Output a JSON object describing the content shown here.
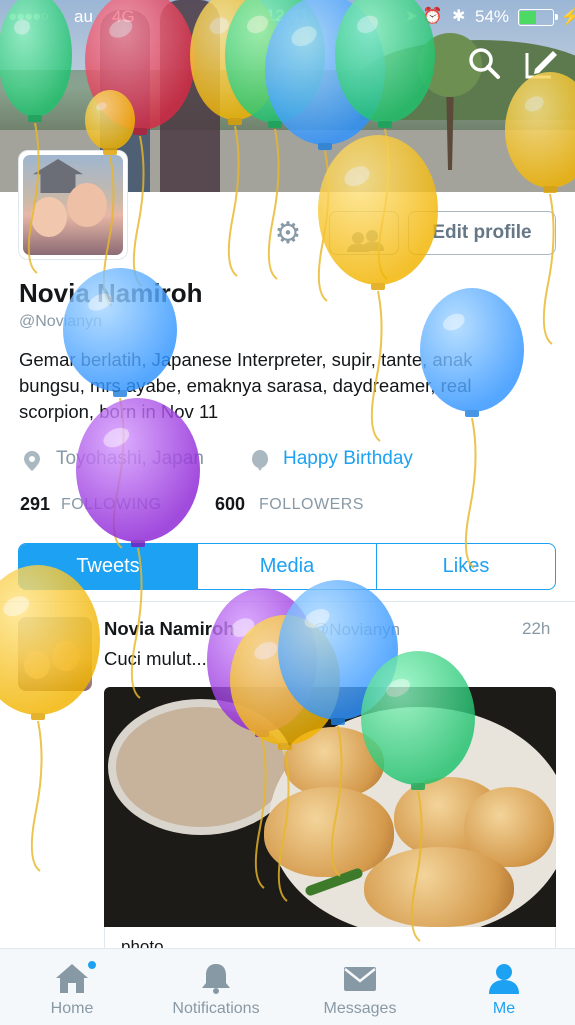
{
  "status_bar": {
    "signal": "●●●●○",
    "carrier": "au",
    "network": "4G",
    "time": "12:41",
    "battery_percent": "54%",
    "battery_level": 0.54
  },
  "profile": {
    "name": "Novia Namiroh",
    "handle": "@Novianyn",
    "bio": "Gemar berlatih, Japanese Interpreter, supir, tante, anak bungsu, mrs ayabe, emaknya sarasa, daydreamer, real scorpion, born in Nov 11",
    "location": "Toyohashi, Japan",
    "birthday": "Happy Birthday",
    "edit_profile_label": "Edit profile",
    "following_count": "291",
    "following_label": "FOLLOWING",
    "followers_count": "600",
    "followers_label": "FOLLOWERS"
  },
  "tabs": [
    {
      "label": "Tweets",
      "active": true
    },
    {
      "label": "Media",
      "active": false
    },
    {
      "label": "Likes",
      "active": false
    }
  ],
  "tweet": {
    "author": "Novia Namiroh",
    "handle": "@Novianyn",
    "time": "22h",
    "text": "Cuci mulut...",
    "card_label": "photo"
  },
  "tab_bar": [
    {
      "label": "Home",
      "icon": "home-icon",
      "active": false,
      "badge": true
    },
    {
      "label": "Notifications",
      "icon": "bell-icon",
      "active": false,
      "badge": false
    },
    {
      "label": "Messages",
      "icon": "envelope-icon",
      "active": false,
      "badge": false
    },
    {
      "label": "Me",
      "icon": "person-icon",
      "active": true,
      "badge": false
    }
  ],
  "colors": {
    "accent": "#1da1f2",
    "secondary_text": "#8899a6",
    "border": "#aab8c2"
  },
  "overlay": {
    "effect": "birthday-balloons",
    "balloon_colors": [
      "#3ddc84",
      "#e8435a",
      "#ffc928",
      "#49a8ff",
      "#a03ee0"
    ]
  }
}
